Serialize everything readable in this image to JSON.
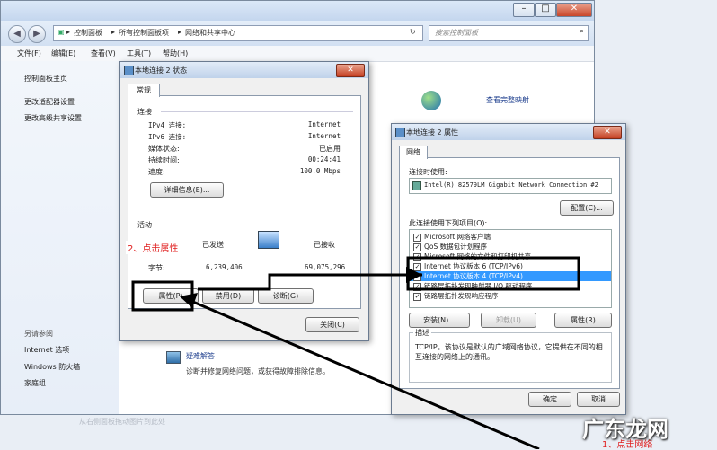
{
  "explorer": {
    "breadcrumb": [
      "控制面板",
      "所有控制面板项",
      "网络和共享中心"
    ],
    "search_placeholder": "搜索控制面板",
    "menu": [
      "文件(F)",
      "编辑(E)",
      "查看(V)",
      "工具(T)",
      "帮助(H)"
    ],
    "sidebar": {
      "home": "控制面板主页",
      "links": [
        "更改适配器设置",
        "更改高级共享设置"
      ],
      "see_also_title": "另请参阅",
      "see_also": [
        "Internet 选项",
        "Windows 防火墙",
        "家庭组"
      ]
    },
    "view_full_map": "查看完整映射",
    "troubleshoot_title": "疑难解答",
    "troubleshoot_desc": "诊断并修复网络问题，或获得故障排除信息。",
    "bottom_faint": "从右侧面板拖动图片到此处"
  },
  "status_dialog": {
    "title": "本地连接 2 状态",
    "tab": "常规",
    "connection_group": "连接",
    "rows": [
      {
        "label": "IPv4 连接:",
        "value": "Internet"
      },
      {
        "label": "IPv6 连接:",
        "value": "Internet"
      },
      {
        "label": "媒体状态:",
        "value": "已启用"
      },
      {
        "label": "持续时间:",
        "value": "00:24:41"
      },
      {
        "label": "速度:",
        "value": "100.0 Mbps"
      }
    ],
    "details_button": "详细信息(E)...",
    "activity_group": "活动",
    "sent_label": "已发送",
    "received_label": "已接收",
    "bytes_label": "字节:",
    "bytes_sent": "6,239,406",
    "bytes_received": "69,075,296",
    "properties_button": "属性(P)",
    "disable_button": "禁用(D)",
    "diagnose_button": "诊断(G)",
    "close_button": "关闭(C)"
  },
  "props_dialog": {
    "title": "本地连接 2 属性",
    "tab": "网络",
    "connect_using_label": "连接时使用:",
    "adapter": "Intel(R) 82579LM Gigabit Network Connection #2",
    "configure_button": "配置(C)...",
    "items_label": "此连接使用下列项目(O):",
    "items": [
      "Microsoft 网络客户端",
      "QoS 数据包计划程序",
      "Microsoft 网络的文件和打印机共享",
      "Internet 协议版本 6 (TCP/IPv6)",
      "Internet 协议版本 4 (TCP/IPv4)",
      "链路层拓扑发现映射器 I/O 驱动程序",
      "链路层拓扑发现响应程序"
    ],
    "selected_index": 4,
    "install_button": "安装(N)...",
    "uninstall_button": "卸载(U)",
    "properties_button": "属性(R)",
    "description_title": "描述",
    "description_text": "TCP/IP。该协议是默认的广域网络协议，它提供在不同的相互连接的网络上的通讯。",
    "ok_button": "确定",
    "cancel_button": "取消"
  },
  "annotations": {
    "step1": "1、点击网络",
    "step2": "2、点击属性"
  },
  "watermark": "广东龙网",
  "colors": {
    "link": "#1b3c8c",
    "annotation": "#e02020",
    "selection": "#3399ff"
  }
}
